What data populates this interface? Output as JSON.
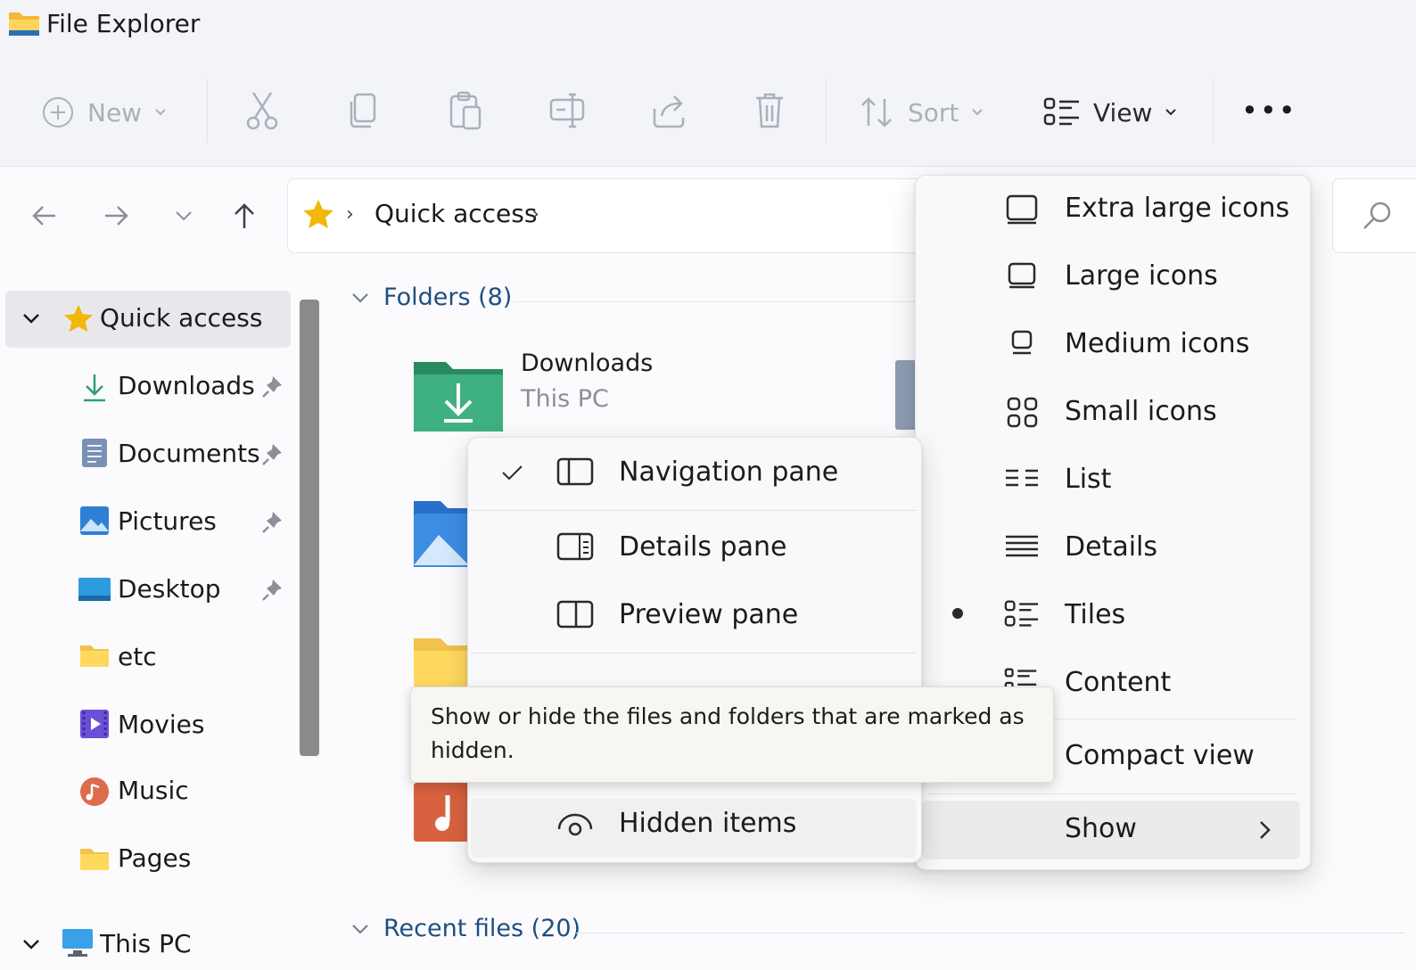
{
  "window": {
    "title": "File Explorer"
  },
  "toolbar": {
    "new_label": "New",
    "sort_label": "Sort",
    "view_label": "View",
    "more_label": "•••"
  },
  "address": {
    "path": [
      "Quick access"
    ]
  },
  "sidebar": {
    "quick_access": "Quick access",
    "items": [
      "Downloads",
      "Documents",
      "Pictures",
      "Desktop",
      "etc",
      "Movies",
      "Music",
      "Pages"
    ],
    "this_pc": "This PC"
  },
  "content": {
    "folders_header": "Folders (8)",
    "recent_header": "Recent files (20)",
    "first_folder": {
      "name": "Downloads",
      "location": "This PC"
    }
  },
  "view_menu": {
    "items": [
      {
        "label": "Extra large icons",
        "icon": "monitor-icon"
      },
      {
        "label": "Large icons",
        "icon": "monitor-icon"
      },
      {
        "label": "Medium icons",
        "icon": "monitor-small-icon"
      },
      {
        "label": "Small icons",
        "icon": "grid-icon"
      },
      {
        "label": "List",
        "icon": "list-icon"
      },
      {
        "label": "Details",
        "icon": "details-icon"
      },
      {
        "label": "Tiles",
        "icon": "tiles-icon",
        "selected": true
      },
      {
        "label": "Content",
        "icon": "content-icon"
      }
    ],
    "compact_view": "Compact view",
    "show": "Show"
  },
  "show_submenu": {
    "items": [
      {
        "label": "Navigation pane",
        "checked": true
      },
      {
        "label": "Details pane",
        "checked": false
      },
      {
        "label": "Preview pane",
        "checked": false
      },
      {
        "label": "Hidden items",
        "checked": false
      }
    ]
  },
  "tooltip": {
    "text": "Show or hide the files and folders that are marked as hidden."
  }
}
